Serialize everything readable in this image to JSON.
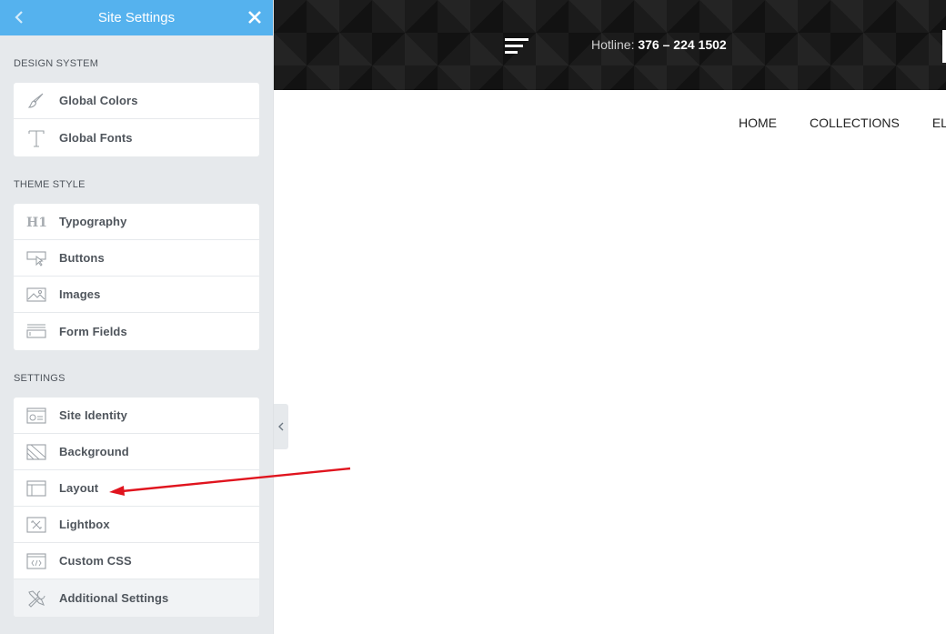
{
  "sidebar": {
    "title": "Site Settings",
    "sections": [
      {
        "title": "DESIGN SYSTEM",
        "items": [
          {
            "label": "Global Colors",
            "icon": "brush-icon"
          },
          {
            "label": "Global Fonts",
            "icon": "typeface-t-icon"
          }
        ]
      },
      {
        "title": "THEME STYLE",
        "items": [
          {
            "label": "Typography",
            "icon": "h1-heading-icon"
          },
          {
            "label": "Buttons",
            "icon": "button-cursor-icon"
          },
          {
            "label": "Images",
            "icon": "image-icon"
          },
          {
            "label": "Form Fields",
            "icon": "form-field-icon"
          }
        ]
      },
      {
        "title": "SETTINGS",
        "items": [
          {
            "label": "Site Identity",
            "icon": "site-identity-icon"
          },
          {
            "label": "Background",
            "icon": "background-icon"
          },
          {
            "label": "Layout",
            "icon": "layout-icon"
          },
          {
            "label": "Lightbox",
            "icon": "lightbox-icon"
          },
          {
            "label": "Custom CSS",
            "icon": "custom-css-icon"
          },
          {
            "label": "Additional Settings",
            "icon": "tools-icon"
          }
        ]
      }
    ]
  },
  "preview": {
    "hotline_label": "Hotline:",
    "hotline_number": "376 – 224 1502",
    "nav": [
      "HOME",
      "COLLECTIONS",
      "ELEMENTS"
    ]
  },
  "colors": {
    "header_blue": "#55b2ee",
    "sidebar_bg": "#e6e9ec",
    "annotation_arrow": "#e0141e"
  }
}
